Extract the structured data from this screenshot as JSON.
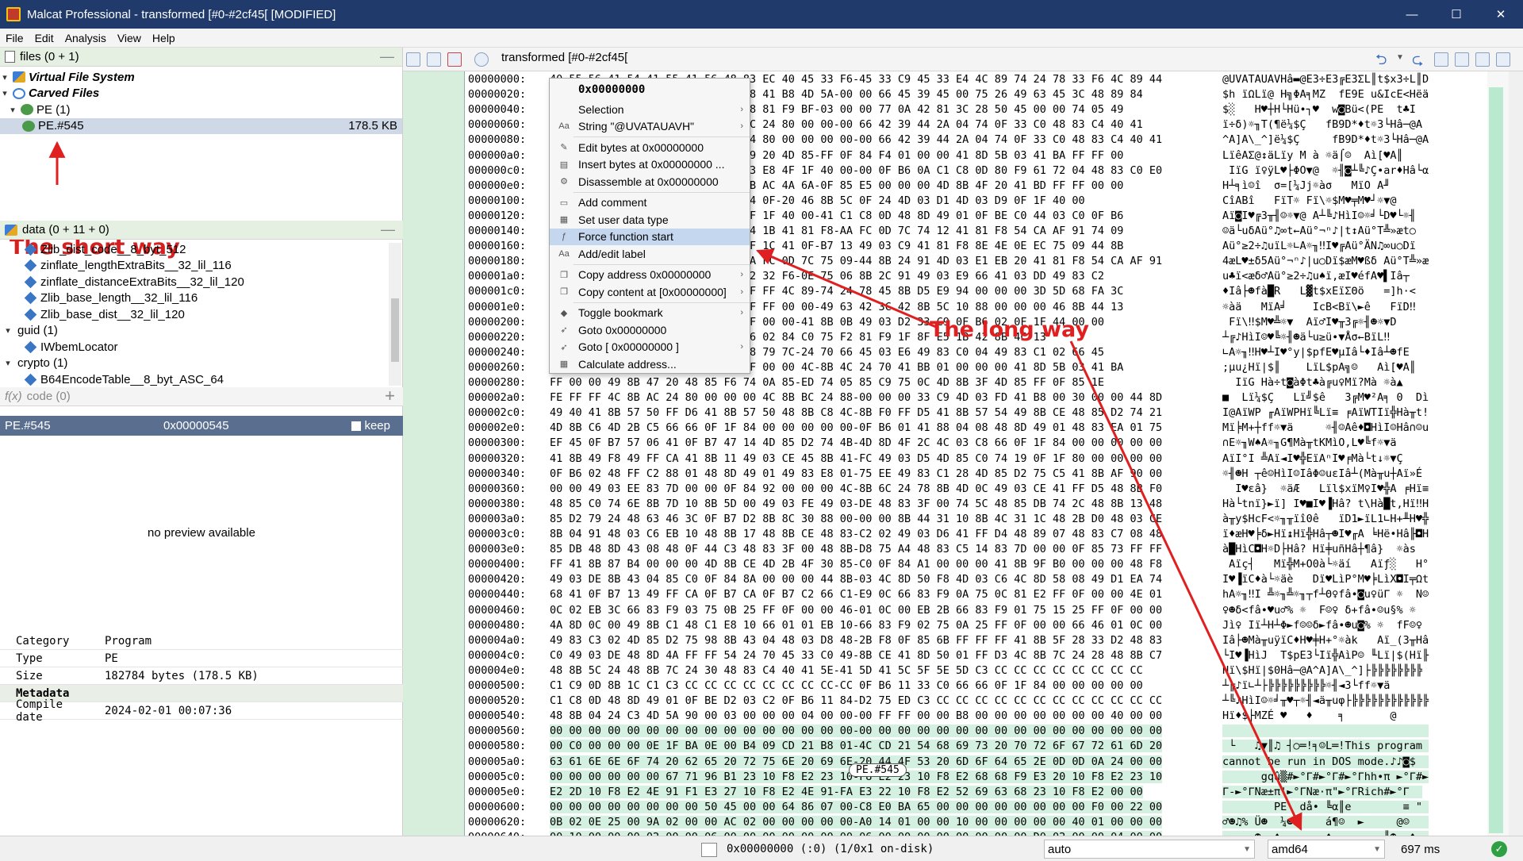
{
  "window": {
    "title": "Malcat Professional - transformed [#0-#2cf45[ [MODIFIED]",
    "minimize": "—",
    "maximize": "☐",
    "close": "✕"
  },
  "menu": [
    "File",
    "Edit",
    "Analysis",
    "View",
    "Help"
  ],
  "files_panel": {
    "header": "files (0 + 1)",
    "vfs": "Virtual File System",
    "carved": "Carved Files",
    "pe": "PE (1)",
    "pe_item": "PE.#545",
    "pe_size": "178.5 KB"
  },
  "annotation_short": "The short way",
  "annotation_long": "The long way",
  "data_panel": {
    "header": "data (0 + 11 + 0)",
    "items": [
      "Zlib_dist_code__8_byt_512",
      "zinflate_lengthExtraBits__32_lil_116",
      "zinflate_distanceExtraBits__32_lil_120",
      "Zlib_base_length__32_lil_116",
      "Zlib_base_dist__32_lil_120"
    ],
    "guid": "guid (1)",
    "guid_item": "IWbemLocator",
    "crypto": "crypto (1)",
    "crypto_item": "B64EncodeTable__8_byt_ASC_64"
  },
  "code_panel": {
    "header": "code (0)"
  },
  "selection_bar": {
    "name": "PE.#545",
    "offset": "0x00000545",
    "keep": "keep"
  },
  "preview": "no preview available",
  "properties": {
    "rows": [
      {
        "key": "Category",
        "value": "Program"
      },
      {
        "key": "Type",
        "value": "PE"
      },
      {
        "key": "Size",
        "value": "182784 bytes (178.5 KB)"
      }
    ],
    "group": "Metadata",
    "compile_key": "Compile date",
    "compile_value": "2024-02-01 00:07:36"
  },
  "tab_title": "transformed [#0-#2cf45[",
  "context_menu": {
    "header": "0x00000000",
    "items": [
      {
        "label": "Selection",
        "icon": "",
        "sub": true
      },
      {
        "label": "String \"@UVATAUAVH\"",
        "icon": "Aa",
        "sub": true
      },
      {
        "label": "Edit bytes at 0x00000000",
        "icon": "✎",
        "sub": false
      },
      {
        "label": "Insert bytes at 0x00000000 ...",
        "icon": "▤",
        "sub": false
      },
      {
        "label": "Disassemble at 0x00000000",
        "icon": "⚙",
        "sub": false
      },
      {
        "label": "Add comment",
        "icon": "▭",
        "sub": false
      },
      {
        "label": "Set user data type",
        "icon": "▦",
        "sub": false
      },
      {
        "label": "Force function start",
        "icon": "ƒ",
        "sub": false
      },
      {
        "label": "Add/edit label",
        "icon": "Aa",
        "sub": false
      },
      {
        "label": "Copy address 0x00000000",
        "icon": "❐",
        "sub": true
      },
      {
        "label": "Copy content at [0x00000000]",
        "icon": "❐",
        "sub": true
      },
      {
        "label": "Toggle bookmark",
        "icon": "◆",
        "sub": true
      },
      {
        "label": "Goto 0x00000000",
        "icon": "➶",
        "sub": false
      },
      {
        "label": "Goto [ 0x00000000 ]",
        "icon": "➶",
        "sub": true
      },
      {
        "label": "Calculate address...",
        "icon": "▦",
        "sub": false
      }
    ]
  },
  "hex_rows": [
    {
      "addr": "00000000:",
      "hex": "40 55 56 41 54 41 55 41 56 48 83 EC 40 45 33 F6-45 33 C9 45 33 E4 4C 89 74 24 78 33 F6 4C 89 44",
      "ascii": "@UVATAUAVHâ▬@E3÷E3╔E3ΣL║t$x3÷L║D"
    },
    {
      "addr": "00000020:",
      "hex": "24 68 8B EA 4C 8B 40 00 48 BB E8 41 B8 4D 5A-00 00 66 45 39 45 00 75 26 49 63 45 3C 48 89 84",
      "ascii": "$h ïΩLï@ H╗ΦA╕MZ  fE9E u&IcE<Hëä"
    },
    {
      "addr": "00000040:",
      "hex": "24 B0 00 00 00 48 03 C5 48 C0 48 81 F9 BF-03 00 00 77 0A 42 81 3C 28 50 45 00 00 74 05 49",
      "ascii": "$░   H♥┼H└Hü∙┐♥  w◙Bü<(PE  t♣I"
    },
    {
      "addr": "00000060:",
      "hex": "8B F6 EB 29 0F B7 54 28 14 89 AC 24 80 00 00-00 66 42 39 44 2A 04 74 0F 33 C0 48 83 C4 40 41",
      "ascii": "ï÷δ)☼╖T(¶ë¼$Ç   fB9D*♦t☼3└Hâ─@A"
    },
    {
      "addr": "00000080:",
      "hex": "5E 41 5D 41 5C 5F 5E 5D 89 AC 24 80 00 00 00 00-00 66 42 39 44 2A 04 74 0F 33 C0 48 83 C4 40 41",
      "ascii": "^A]A\\_^]ë¼$Ç     fB9D*♦t☼3└Hâ─@A"
    },
    {
      "addr": "000000a0:",
      "hex": "4C 8B 88 AC 24 40 12 84 4C 8B 79 20 4D 85-FF 0F 84 F4 01 00 00 41 8D 5B 03 41 BA FF FF 00",
      "ascii": "LïêAΣ@↕äLïy M à ☼ä⌠☺  Aì[♥A║  "
    },
    {
      "addr": "000000c0:",
      "hex": "00 49 8B 47 20 8B 0C 98 4C 03 C3 E8 4F 1F 40 00-00 0F B6 0A C1 C8 0D 80 F9 61 72 04 48 83 C0 E0",
      "ascii": " IïG ï♀ÿL♥├ΦO▼@  ☼╢◙┴╚♪Ç∙ar♦Hâ└α"
    },
    {
      "addr": "000000e0:",
      "hex": "48 C1 B8 8D 01 8C 00 00 E5 3D 5B AC 4A 6A-0F 85 E5 00 00 00 4D 8B 4F 20 41 BD FF FF 00 00",
      "ascii": "H┴╕ì☺î  σ=[¼Jj☼àσ   MïO A╜    "
    },
    {
      "addr": "00000100:",
      "hex": "43 8C 41 42 8C 00 00 00 46 8B 54 0F-20 46 8B 5C 0F 24 4D 03 D1 4D 03 D9 0F 1F 40 00",
      "ascii": "CîABî   FïT☼ Fï\\☼$M♥╤M♥┘☼▼@ "
    },
    {
      "addr": "00000120:",
      "hex": "41 8B 0A 49 03 C9 33 D2 B6 01 0F 1F 40 00-41 C1 C8 0D 48 8D 49 01 0F BE C0 44 03 C0 0F B6",
      "ascii": "Aï◙I♥╔3╥╢☺☼▼@ A┴╚♪HìI☺☼╛└D♥└☼╢"
    },
    {
      "addr": "00000140:",
      "hex": "01 84 C0 75 EB 41 81 F8 0E EC 74 1B 41 81 F8-AA FC 0D 7C 74 12 41 81 F8 54 CA AF 91 74 09",
      "ascii": "☺ä└uδAü°♫∞t←Aü°¬ⁿ♪|t↕Aü°T╩»æt○"
    },
    {
      "addr": "00000160:",
      "hex": "41 81 F8 F2 32 F6 0E 75 8B 4C 0F 1C 41 0F-B7 13 49 03 C9 41 81 F8 8E 4E 0E EC 75 09 44 8B",
      "ascii": "Aü°≥2÷♫uïL☼∟A☼╖‼I♥╔Aü°ÄN♫∞u○Dï"
    },
    {
      "addr": "00000180:",
      "hex": "34 91 4C 03 F1 EB 35 41 81 F8 AA FC 0D 7C 75 09-44 8B 24 91 4D 03 E1 EB 20 41 81 F8 54 CA AF 91",
      "ascii": "4æL♥±δ5Aü°¬ⁿ♪|u○Dï$æM♥ßδ Aü°T╩»æ"
    },
    {
      "addr": "000001a0:",
      "hex": "75 05 8B 3C 91 EB 0B 41 81 F8 F2 32 F6-0E 75 06 8B 2C 91 49 03 E9 66 41 03 DD 49 83 C2",
      "ascii": "u♣ï<æδ♂Aü°≥2÷♫u♠ï,æI♥éfA♥▌Iâ┬"
    },
    {
      "addr": "000001c0:",
      "hex": "04 49 83 C3 02 66 85 DB 52 FF FF FF 4C 89-74 24 78 45 8B D5 E9 94 00 00 00 3D 5D 68 FA 3C",
      "ascii": "♦Iâ├☻fà█R   L▓t$xEïΣΘö   =]h·<"
    },
    {
      "addr": "000001e0:",
      "hex": "0F 85 84 00 00 00 4D 8B 41 BE FF FF 00 00-49 63 42 3C 42 8B 5C 10 88 00 00 00 46 8B 44 13",
      "ascii": "☼àä   MïA╛    IcB<Bï\\►ê   FïD‼"
    },
    {
      "addr": "00000200:",
      "hex": "20 46 8B 5C 13 24 4D 03 CA 0F 1F 00 00-41 8B 0B 49 03 D2 33 C9 0F B6 02 0F 1F 44 00 00",
      "ascii": " Fï\\‼$M♥╩☼▼  Aï♂I♥╥3╔☼╢☻☼▼D  "
    },
    {
      "addr": "00000220:",
      "hex": "C1 C9 0D 48 8D 49 01 03 C8 0F B6 02 84 C0 75 F2 81 F9 1F 8F E5 1B 42 8B 4C 13",
      "ascii": "┴╔♪HìI☺♥╚☼╢☻ä└u≥ü∙▼Åσ←BïL‼"
    },
    {
      "addr": "00000240:",
      "hex": "1C 41 0F B7 13 48 03 C1 49 03 F8 79 7C-24 70 66 45 03 E6 49 83 C0 04 49 83 C1 02 66 45",
      "ascii": "∟A☼╖‼H♥┴I♥°y|$pfE♥µIâ└♦Iâ┴☻fE"
    },
    {
      "addr": "00000260:",
      "hex": "3B E6 75 A8 48 8B 7C 24 BA FF FF 00 00 4C-8B 4C 24 70 41 BB 01 00 00 00 41 8D 5B 03 41 BA",
      "ascii": ";µu¿Hï|$║    LïL$pA╗☺   Aì[♥A║"
    },
    {
      "addr": "00000280:",
      "hex": "FF 00 00 49 8B 47 20 48 85 F6 74 0A 85-ED 74 05 85 C9 75 0C 4D 8B 3F 4D 85 FF 0F 85 1E",
      "ascii": "  IïG Hà÷t◙àΦt♣à╔u♀Mï?Mà ☼à▲"
    },
    {
      "addr": "000002a0:",
      "hex": "FE FF FF 4C 8B AC 24 80 00 00 00 4C 8B BC 24 88-00 00 00 33 C9 4D 03 FD 41 B8 00 30 00 00 44 8D",
      "ascii": "■  Lï¼$Ç   Lï╝$ê   3╔M♥²A╕ 0  Dì"
    },
    {
      "addr": "000002c0:",
      "hex": "49 40 41 8B 57 50 FF D6 41 8B 57 50 48 8B C8 4C-8B F0 FF D5 41 8B 57 54 49 8B CE 48 85 D2 74 21",
      "ascii": "I@AïWP ╓AïWPHï╚Lï≡ ╒AïWTIï╬Hà╥t!"
    },
    {
      "addr": "000002e0:",
      "hex": "4D 8B C6 4D 2B C5 66 66 0F 1F 84 00 00 00 00 00-0F B6 01 41 88 04 08 48 8D 49 01 48 83 EA 01 75",
      "ascii": "Mï╞M+┼ff☼▼ä     ☼╢☺Aê♦◘HìI☺Hâ∩☺u"
    },
    {
      "addr": "00000300:",
      "hex": "EF 45 0F B7 57 06 41 0F B7 47 14 4D 85 D2 74 4B-4D 8D 4F 2C 4C 03 C8 66 0F 1F 84 00 00 00 00 00",
      "ascii": "∩E☼╖W♠A☼╖G¶Mà╥tKMìO,L♥╚f☼▼ä     "
    },
    {
      "addr": "00000320:",
      "hex": "41 8B 49 F8 49 FF CA 41 8B 11 49 03 CE 45 8B 41-FC 49 03 D5 4D 85 C0 74 19 0F 1F 80 00 00 00 00",
      "ascii": "AïI°I ╩Aï◄I♥╬EïAⁿI♥╒Mà└t↓☼▼Ç    "
    },
    {
      "addr": "00000340:",
      "hex": "0F B6 02 48 FF C2 88 01 48 8D 49 01 49 83 E8 01-75 EE 49 83 C1 28 4D 85 D2 75 C5 41 8B AF 90 00",
      "ascii": "☼╢☻H ┬ê☺HìI☺IâΦ☺uεIâ┴(Mà╥u┼Aï»É "
    },
    {
      "addr": "00000360:",
      "hex": "00 00 49 03 EE 83 7D 00 00 0F 84 92 00 00 00 4C-8B 6C 24 78 8B 4D 0C 49 03 CE 41 FF D5 48 8B F0",
      "ascii": "  I♥εâ}  ☼äÆ   Lïl$xïM♀I♥╬A ╒Hï≡"
    },
    {
      "addr": "00000380:",
      "hex": "48 85 C0 74 6E 8B 7D 10 8B 5D 00 49 03 FE 49 03-DE 48 83 3F 00 74 5C 48 85 DB 74 2C 48 8B 13 48",
      "ascii": "Hà└tnï}►ï] I♥■I♥▐Hâ? t\\Hà█t,Hï‼H"
    },
    {
      "addr": "000003a0:",
      "hex": "85 D2 79 24 48 63 46 3C 0F B7 D2 8B 8C 30 88 00-00 00 8B 44 31 10 8B 4C 31 1C 48 2B D0 48 03 CE",
      "ascii": "à╥y$HcF<☼╖╥ïî0ê   ïD1►ïL1∟H+╨H♥╬"
    },
    {
      "addr": "000003c0:",
      "hex": "8B 04 91 48 03 C6 EB 10 48 8B 17 48 8B CE 48 83-C2 02 49 03 D6 41 FF D4 48 89 07 48 83 C7 08 48",
      "ascii": "ï♦æH♥╞δ►Hï↨Hï╬Hâ┬☻I♥╓A ╘Hë•Hâ╟◘H"
    },
    {
      "addr": "000003e0:",
      "hex": "85 DB 48 8D 43 08 48 0F 44 C3 48 83 3F 00 48 8B-D8 75 A4 48 83 C5 14 83 7D 00 00 0F 85 73 FF FF",
      "ascii": "à█HìC◘H☼D├Hâ? Hï╪uñHâ┼¶â}  ☼às  "
    },
    {
      "addr": "00000400:",
      "hex": "FF 41 8B 87 B4 00 00 00 4D 8B CE 4D 2B 4F 30 85-C0 0F 84 A1 00 00 00 41 8B 9F B0 00 00 00 48 F8",
      "ascii": " Aïç┤   Mï╬M+O0à└☼äí   Aïƒ░   H°"
    },
    {
      "addr": "00000420:",
      "hex": "49 03 DE 8B 43 04 85 C0 0F 84 8A 00 00 00 44 8B-03 4C 8D 50 F8 4D 03 C6 4C 8D 58 08 49 D1 EA 74",
      "ascii": "I♥▐ïC♦à└☼äè   Dï♥LìP°M♥╞LìX◘I╤Ωt"
    },
    {
      "addr": "00000440:",
      "hex": "68 41 0F B7 13 49 FF CA 0F B7 CA 0F B7 C2 66 C1-E9 0C 66 83 F9 0A 75 0C 81 E2 FF 0F 00 00 4E 01",
      "ascii": "hA☼╖‼I ╩☼╖╩☼╖┬f┴Θ♀fâ∙◙u♀üΓ ☼  N☺"
    },
    {
      "addr": "00000460:",
      "hex": "0C 02 EB 3C 66 83 F9 03 75 0B 25 FF 0F 00 00 46-01 0C 00 EB 2B 66 83 F9 01 75 15 25 FF 0F 00 00",
      "ascii": "♀☻δ<fâ∙♥u♂% ☼  F☺♀ δ+fâ∙☺u§% ☼  "
    },
    {
      "addr": "00000480:",
      "hex": "4A 8D 0C 00 49 8B C1 48 C1 E8 10 66 01 01 EB 10-66 83 F9 02 75 0A 25 FF 0F 00 00 66 46 01 0C 00",
      "ascii": "Jì♀ Iï┴H┴Φ►f☺☺δ►fâ∙☻u◙% ☼  fF☺♀ "
    },
    {
      "addr": "000004a0:",
      "hex": "49 83 C3 02 4D 85 D2 75 98 8B 43 04 48 03 D8 48-2B F8 0F 85 6B FF FF FF 41 8B 5F 28 33 D2 48 83",
      "ascii": "Iâ├☻Mà╥uÿïC♦H♥╪H+°☼àk   Aï_(3╥Hâ"
    },
    {
      "addr": "000004c0:",
      "hex": "C0 49 03 DE 48 8D 4A FF FF 54 24 70 45 33 C0 49-8B CE 41 8D 50 01 FF D3 4C 8B 7C 24 28 48 8B C7",
      "ascii": "└I♥▐HìJ  T$pE3└Iï╬AìP☺ ╙Lï|$(Hï╟"
    },
    {
      "addr": "000004e0:",
      "hex": "48 8B 5C 24 48 8B 7C 24 30 48 83 C4 40 41 5E-41 5D 41 5C 5F 5E 5D C3 CC CC CC CC CC CC CC CC",
      "ascii": "Hï\\$Hï|$0Hâ─@A^A]A\\_^]├╠╠╠╠╠╠╠╠"
    },
    {
      "addr": "00000500:",
      "hex": "C1 C9 0D 8B 1C C1 C3 CC CC CC CC CC CC CC CC-CC 0F B6 11 33 C0 66 66 0F 1F 84 00 00 00 00 00",
      "ascii": "┴╔♪ï∟┴├╠╠╠╠╠╠╠╠╠☼╢◄3└ff☼▼ä     "
    },
    {
      "addr": "00000520:",
      "hex": "C1 C8 0D 48 8D 49 01 0F BE D2 03 C2 0F B6 11 84-D2 75 ED C3 CC CC CC CC CC CC CC CC CC CC CC CC",
      "ascii": "┴╚♪HìI☺☼╛╥♥┬☼╢◄ä╥uφ├╠╠╠╠╠╠╠╠╠╠╠╠"
    },
    {
      "addr": "00000540:",
      "hex": "48 8B 04 24 C3 4D 5A 90 00 03 00 00 00 04 00 00-00 FF FF 00 00 B8 00 00 00 00 00 00 00 40 00 00",
      "ascii": "Hï♦$├MZÉ ♥   ♦    ╕       @  "
    },
    {
      "addr": "00000560:",
      "hex": "00 00 00 00 00 00 00 00 00 00 00 00 00 00 00 00-00 00 00 00 00 00 00 00 00 00 00 00 00 00 00 00",
      "ascii": "                                "
    },
    {
      "addr": "00000580:",
      "hex": "00 C0 00 00 00 0E 1F BA 0E 00 B4 09 CD 21 B8 01-4C CD 21 54 68 69 73 20 70 72 6F 67 72 61 6D 20",
      "ascii": " └   ♫▼║♫ ┤○═!╕☺L═!This program "
    },
    {
      "addr": "000005a0:",
      "hex": "63 61 6E 6E 6F 74 20 62 65 20 72 75 6E 20 69 6E-20 44 4F 53 20 6D 6F 64 65 2E 0D 0D 0A 24 00 00",
      "ascii": "cannot be run in DOS mode.♪♪◙$  "
    },
    {
      "addr": "000005c0:",
      "hex": "00 00 00 00 00 00 67 71 96 B1 23 10 F8 E2 23 10-F8 E2 23 10 F8 E2 68 68 F9 E3 20 10 F8 E2 23 10",
      "ascii": "      gqû▒#►°Γ#►°Γ#►°Γhh∙π ►°Γ#►"
    },
    {
      "addr": "000005e0:",
      "hex": "E2 2D 10 F8 E2 4E 91 F1 E3 27 10 F8 E2 4E 91-FA E3 22 10 F8 E2 52 69 63 68 23 10 F8 E2 00 00",
      "ascii": "Γ-►°ΓNæ±π'►°ΓNæ·π\"►°ΓRich#►°Γ  "
    },
    {
      "addr": "00000600:",
      "hex": "00 00 00 00 00 00 00 00 50 45 00 00 64 86 07 00-C8 E0 BA 65 00 00 00 00 00 00 00 00 F0 00 22 00",
      "ascii": "        PE  då• ╚α║e        ≡ \" "
    },
    {
      "addr": "00000620:",
      "hex": "0B 02 0E 25 00 9A 02 00 00 AC 02 00 00 00 00 00-A0 14 01 00 00 10 00 00 00 00 00 40 01 00 00 00",
      "ascii": "♂☻♫% Ü☻  ¼☻     á¶☺  ►     @☺   "
    },
    {
      "addr": "00000640:",
      "hex": "00 10 00 00 00 02 00 00 06 00 00 00 00 00 00 00-06 00 00 00 00 00 00 00 00 D0 02 00 00 04 00 00",
      "ascii": " ►   ☻  ♠       ♠        ╨☻  ♦  "
    }
  ],
  "pe_badge": "PE.#545",
  "status": {
    "position": "0x00000000 (:0) (1/0x1 on-disk)",
    "mode": "auto",
    "arch": "amd64",
    "time": "697 ms"
  }
}
